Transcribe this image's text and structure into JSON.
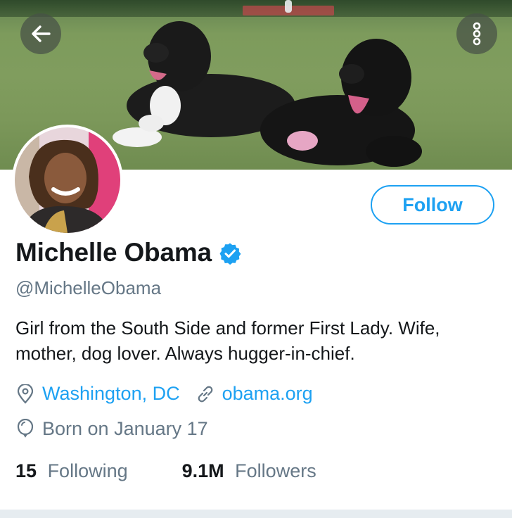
{
  "profile": {
    "name": "Michelle Obama",
    "handle": "@MichelleObama",
    "verified": true,
    "bio": "Girl from the South Side and former First Lady. Wife, mother, dog lover. Always hugger-in-chief.",
    "location": "Washington, DC",
    "website": "obama.org",
    "birthday": "Born on January 17"
  },
  "actions": {
    "follow_label": "Follow"
  },
  "stats": {
    "following_count": "15",
    "following_label": "Following",
    "followers_count": "9.1M",
    "followers_label": "Followers"
  },
  "icons": {
    "back": "arrow-left-icon",
    "more": "more-vertical-icon",
    "verified": "verified-badge-icon",
    "location": "location-pin-icon",
    "link": "link-icon",
    "birthday": "balloon-icon"
  },
  "colors": {
    "accent": "#1da1f2",
    "text": "#14171a",
    "muted": "#657786"
  }
}
